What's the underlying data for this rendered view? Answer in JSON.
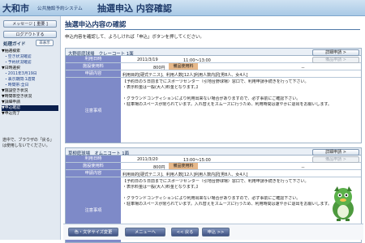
{
  "header": {
    "city": "大和市",
    "system": "公共施設予約システム",
    "title": "抽選申込 内容確認"
  },
  "sidebar": {
    "buttons": [
      "メッセージ [ 重要 ]",
      "ログアウトする"
    ],
    "guide_heading": "処理ガイド",
    "guide_button": "非表示",
    "nav": [
      {
        "label": "▼抽選検索",
        "type": "h"
      },
      {
        "label": "・空き状況確認",
        "type": "s"
      },
      {
        "label": "・予約状況確認",
        "type": "s"
      },
      {
        "label": "▼日時選択",
        "type": "h"
      },
      {
        "label": "・2011年3月19日",
        "type": "s"
      },
      {
        "label": "・表示期間:1週間",
        "type": "s"
      },
      {
        "label": "・時間帯:全日",
        "type": "s"
      },
      {
        "label": "▼施設空き状況",
        "type": "h"
      },
      {
        "label": "▼時間帯空き状況",
        "type": "h"
      },
      {
        "label": "▼詳細申請",
        "type": "h"
      },
      {
        "label": "▼申込確認",
        "type": "cur"
      },
      {
        "label": "▼申込完了",
        "type": "h"
      }
    ],
    "note": "途中で、ブラウザの「戻る」は使用しないでください。"
  },
  "main": {
    "title": "抽選申込内容の確認",
    "intro": "申込内容を確認して、よろしければ「申込」ボタンを押してください。",
    "detail_button": "詳細申請 >",
    "slot_button": "備品申請 >",
    "labels": {
      "usage_date": "利用日時",
      "fee": "施設使用料",
      "equip_fee": "備品使用料",
      "content": "申請内容",
      "notes": "注意事項"
    },
    "cards": [
      {
        "facility": "大野原庭球場　クレーコート 1面",
        "date": "2011/3/19",
        "time": "11:00～13:00",
        "fee": "800円",
        "equip": "－",
        "content": "利用目的[硬式テニス]、利用人数[12人]利用人数内訳[男8人、女4人]",
        "notes": [
          "【予約日の５日前までにスポーツセンター（引地台野球場）窓口で、利用申請手続きを行って下さい。",
          "・表示料金は一般(大人)料金となります。】",
          "",
          "・グラウンドコンディションにより利用出来ない場合がありますので、必ず事前にご確認下さい。",
          "・駐車場のスペースが限られています。入れ替えをスムーズに行うため、利用時間は速やかに退出をお願いします。"
        ]
      },
      {
        "facility": "草柳庭球場　オムニコート 1面",
        "date": "2011/3/20",
        "time": "13:00～15:00",
        "fee": "800円",
        "equip": "－",
        "content": "利用目的[硬式テニス]、利用人数[12人]利用人数内訳[男8人、女4人]",
        "notes": [
          "【予約日の５日前までにスポーツセンター（引地台野球場）窓口で、利用申請手続きを行って下さい。",
          "・表示料金は一般(大人)料金となります。】",
          "",
          "・グラウンドコンディションにより利用出来ない場合がありますので、必ず事前にご確認下さい。",
          "・駐車場のスペースが限られています。入れ替えをスムーズに行うため、利用時間は速やかに退出をお願いします。"
        ]
      }
    ]
  },
  "footer": {
    "buttons": [
      "色・文字サイズ変更",
      "メニューへ",
      "<< 戻る",
      "申込 >>"
    ]
  }
}
